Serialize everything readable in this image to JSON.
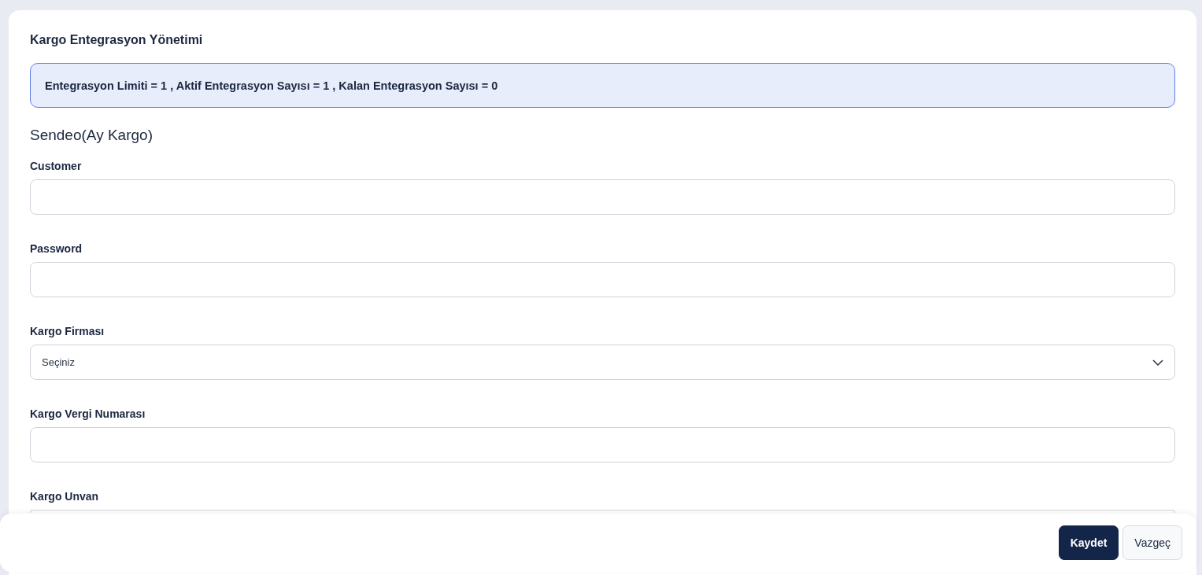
{
  "panel": {
    "title": "Kargo Entegrasyon Yönetimi"
  },
  "info": {
    "text": "Entegrasyon Limiti = 1 , Aktif Entegrasyon Sayısı = 1 , Kalan Entegrasyon Sayısı = 0"
  },
  "section": {
    "title": "Sendeo(Ay Kargo)"
  },
  "fields": [
    {
      "kind": "input",
      "label": "Customer"
    },
    {
      "kind": "input",
      "label": "Password"
    },
    {
      "kind": "select",
      "label": "Kargo Firması",
      "value": "Seçiniz"
    },
    {
      "kind": "input",
      "label": "Kargo Vergi Numarası"
    },
    {
      "kind": "input",
      "label": "Kargo Unvan"
    }
  ],
  "footer": {
    "buttons": [
      {
        "kind": "primary",
        "label": "Kaydet"
      },
      {
        "kind": "secondary",
        "label": "Vazgeç"
      }
    ]
  }
}
